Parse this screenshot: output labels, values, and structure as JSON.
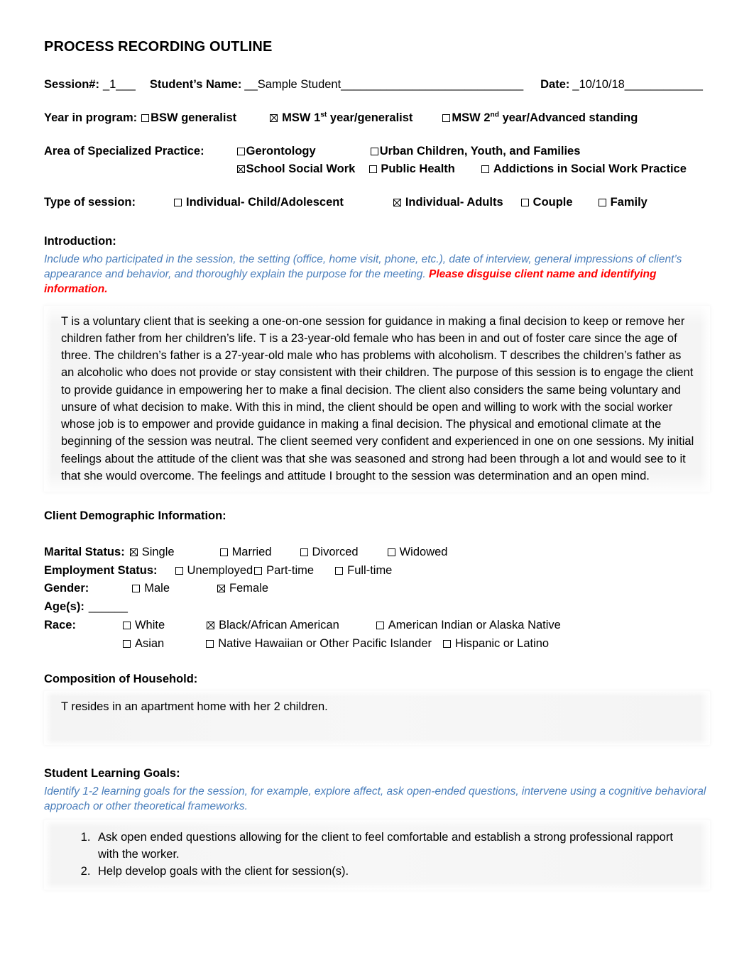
{
  "document": {
    "title": "PROCESS RECORDING OUTLINE"
  },
  "header": {
    "session_label": "Session#:",
    "session_value": "_1___",
    "student_label": "Student’s Name:",
    "student_value": "__Sample Student____________________________",
    "date_label": "Date:",
    "date_value": "_10/10/18____________"
  },
  "year_in_program": {
    "label": "Year in program:",
    "options": [
      {
        "label": "BSW generalist",
        "checked": false,
        "sup": ""
      },
      {
        "label": "MSW 1",
        "sup": "st",
        "label_after": " year/generalist",
        "checked": true
      },
      {
        "label": "MSW 2",
        "sup": "nd",
        "label_after": " year/Advanced standing",
        "checked": false
      }
    ]
  },
  "specialized_practice": {
    "label": "Area of Specialized Practice:",
    "row1": [
      {
        "label": "Gerontology",
        "checked": false
      },
      {
        "label": "Urban Children, Youth, and Families",
        "checked": false
      }
    ],
    "row2": [
      {
        "label": "School Social Work",
        "checked": true
      },
      {
        "label": "Public Health",
        "checked": false
      },
      {
        "label": "Addictions in Social Work Practice",
        "checked": false
      }
    ]
  },
  "type_of_session": {
    "label": "Type of session:",
    "options": [
      {
        "label": "Individual- Child/Adolescent",
        "checked": false
      },
      {
        "label": "Individual- Adults",
        "checked": true
      },
      {
        "label": "Couple",
        "checked": false
      },
      {
        "label": "Family",
        "checked": false
      }
    ]
  },
  "introduction": {
    "heading": "Introduction:",
    "instruction_blue": "Include who participated in the session, the setting (office, home visit, phone, etc.), date of interview, general impressions of client’s appearance and behavior, and thoroughly explain the purpose for the meeting. ",
    "instruction_red": "Please disguise client name and identifying information.",
    "body": "T is a voluntary client that is seeking a one-on-one session for guidance in making a final decision to keep or remove her children father from her children’s life. T is a 23-year-old female who has been in and out of foster care since the age of three. The children’s father is a 27-year-old male who has problems with alcoholism. T describes the children’s father as an alcoholic who does not provide or stay consistent with their children.  The purpose of this session is to engage the client to provide guidance in empowering her to make a final decision. The client also considers the same being voluntary and unsure of what decision to make. With this in mind, the client should be open and willing to work with the social worker whose job is to empower and provide guidance in making a final decision. The physical and emotional climate at the beginning of the session was neutral. The client seemed very confident and experienced in one on one sessions. My initial feelings about the attitude of the client was that she was seasoned and strong had been through a lot and would see to it that she would overcome. The feelings and attitude I brought to the session was determination and an open mind."
  },
  "demographics": {
    "heading": "Client Demographic Information:",
    "marital": {
      "label": "Marital Status:",
      "options": [
        {
          "label": "Single",
          "checked": true
        },
        {
          "label": "Married",
          "checked": false
        },
        {
          "label": "Divorced",
          "checked": false
        },
        {
          "label": "Widowed",
          "checked": false
        }
      ]
    },
    "employment": {
      "label": "Employment Status:",
      "options": [
        {
          "label": "Unemployed",
          "checked": false
        },
        {
          "label": "Part-time",
          "checked": false
        },
        {
          "label": "Full-time",
          "checked": false
        }
      ]
    },
    "gender": {
      "label": "Gender:",
      "options": [
        {
          "label": "Male",
          "checked": false
        },
        {
          "label": "Female",
          "checked": true
        }
      ]
    },
    "ages": {
      "label": "Age(s):",
      "value": "______"
    },
    "race": {
      "label": "Race:",
      "row1": [
        {
          "label": "White",
          "checked": false
        },
        {
          "label": "Black/African American",
          "checked": true
        },
        {
          "label": "American Indian or Alaska Native",
          "checked": false
        }
      ],
      "row2": [
        {
          "label": "Asian",
          "checked": false
        },
        {
          "label": "Native Hawaiian or Other Pacific Islander",
          "checked": false
        },
        {
          "label": "Hispanic or Latino",
          "checked": false
        }
      ]
    }
  },
  "household": {
    "heading": "Composition of Household:",
    "body": "T resides in an apartment home with her 2 children."
  },
  "learning_goals": {
    "heading": "Student Learning Goals:",
    "instruction_blue": "Identify 1-2 learning goals for the session, for example, explore affect, ask open-ended questions, intervene using a cognitive behavioral approach or other theoretical frameworks.",
    "items": [
      "Ask open ended questions allowing for the client to feel comfortable and establish a strong professional rapport with the worker.",
      "Help develop goals with the client for session(s)."
    ]
  },
  "colors": {
    "instruction_blue": "#4A7EBB",
    "instruction_red": "#FF0000",
    "text": "#000000",
    "box_shade": "#F4F4F4"
  }
}
